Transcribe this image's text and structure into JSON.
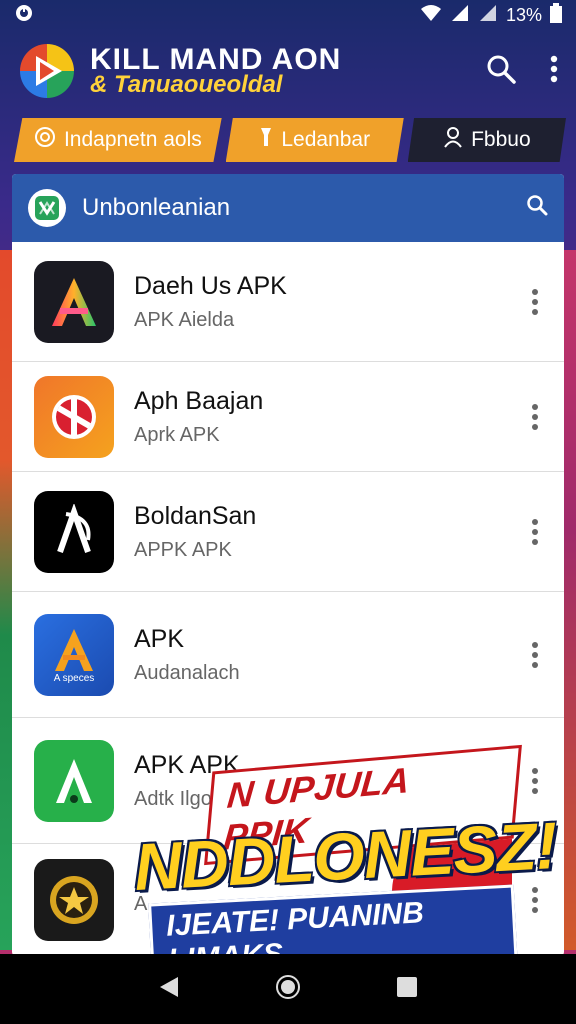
{
  "status": {
    "battery": "13%"
  },
  "appbar": {
    "title_line1": "KILL MAND AON",
    "title_line2": "& Tanuaoueoldal"
  },
  "chips": [
    {
      "label": "Indapnetn aols"
    },
    {
      "label": "Ledanbar"
    },
    {
      "label": "Fbbuo"
    }
  ],
  "panel": {
    "title": "Unbonleanian"
  },
  "apps": [
    {
      "name": "Daeh Us APK",
      "sub": "APK Aielda"
    },
    {
      "name": "Aph Baajan",
      "sub": "Aprk APK"
    },
    {
      "name": "BoldanSan",
      "sub": "APPK APK"
    },
    {
      "name": "APK",
      "sub": "Audanalach"
    },
    {
      "name": "APK APK",
      "sub": "Adtk Ilgo"
    },
    {
      "name": "",
      "sub": "A"
    }
  ],
  "icon_labels": {
    "app4": "A speces"
  },
  "promo": {
    "line1": "N UPJULA PPIK",
    "line2": "NDDLONESZ!",
    "line3": "IJEATE! PUANINB LIMAKS"
  },
  "colors": {
    "accent_orange": "#f0a12a",
    "panel_blue": "#2c5aab",
    "promo_yellow": "#ffcf1f",
    "promo_red": "#d81b27"
  }
}
